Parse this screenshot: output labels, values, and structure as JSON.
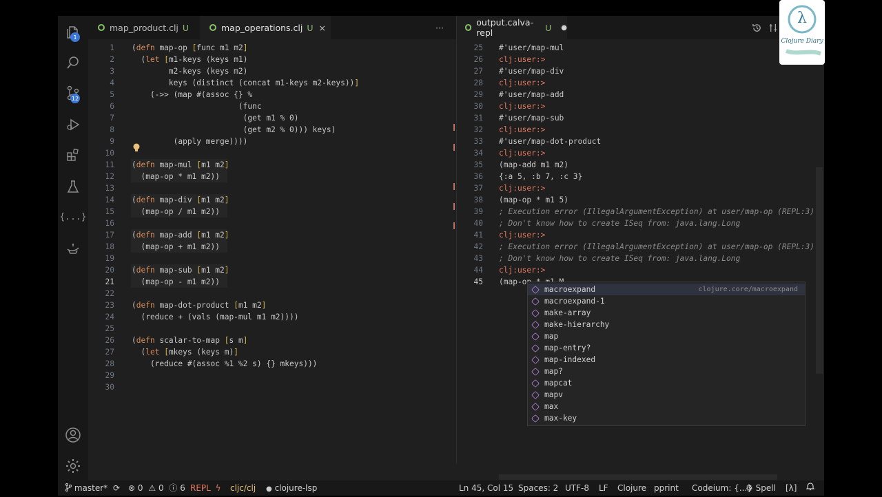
{
  "tabs_left": [
    {
      "label": "map_product.clj",
      "status": "U"
    },
    {
      "label": "map_operations.clj",
      "status": "U",
      "close": "×"
    }
  ],
  "tabs_left_more": "···",
  "tabs_right": [
    {
      "label": "output.calva-repl",
      "status": "U",
      "dirty": "●"
    }
  ],
  "activity_badges": {
    "explorer": "1",
    "scm": "12"
  },
  "activity_text": "{...}",
  "left_editor": {
    "current_line": 21,
    "lines": [
      {
        "n": "1",
        "t": "(defn map-op [func m1 m2]"
      },
      {
        "n": "2",
        "t": "  (let [m1-keys (keys m1)"
      },
      {
        "n": "3",
        "t": "        m2-keys (keys m2)"
      },
      {
        "n": "4",
        "t": "        keys (distinct (concat m1-keys m2-keys))]"
      },
      {
        "n": "5",
        "t": "    (->> (map #(assoc {} %"
      },
      {
        "n": "6",
        "t": "                       (func"
      },
      {
        "n": "7",
        "t": "                        (get m1 % 0)"
      },
      {
        "n": "8",
        "t": "                        (get m2 % 0))) keys)"
      },
      {
        "n": "9",
        "t": "         (apply merge))))"
      },
      {
        "n": "10",
        "t": ""
      },
      {
        "n": "11",
        "t": "(defn map-mul [m1 m2]"
      },
      {
        "n": "12",
        "t": "  (map-op * m1 m2))"
      },
      {
        "n": "13",
        "t": ""
      },
      {
        "n": "14",
        "t": "(defn map-div [m1 m2]"
      },
      {
        "n": "15",
        "t": "  (map-op / m1 m2))"
      },
      {
        "n": "16",
        "t": ""
      },
      {
        "n": "17",
        "t": "(defn map-add [m1 m2]"
      },
      {
        "n": "18",
        "t": "  (map-op + m1 m2))"
      },
      {
        "n": "19",
        "t": ""
      },
      {
        "n": "20",
        "t": "(defn map-sub [m1 m2]"
      },
      {
        "n": "21",
        "t": "  (map-op - m1 m2))"
      },
      {
        "n": "22",
        "t": ""
      },
      {
        "n": "23",
        "t": "(defn map-dot-product [m1 m2]"
      },
      {
        "n": "24",
        "t": "  (reduce + (vals (map-mul m1 m2))))"
      },
      {
        "n": "25",
        "t": ""
      },
      {
        "n": "26",
        "t": "(defn scalar-to-map [s m]"
      },
      {
        "n": "27",
        "t": "  (let [mkeys (keys m)]"
      },
      {
        "n": "28",
        "t": "    (reduce #(assoc %1 %2 s) {} mkeys)))"
      },
      {
        "n": "29",
        "t": ""
      },
      {
        "n": "30",
        "t": ""
      }
    ]
  },
  "repl": {
    "lines": [
      {
        "n": "25",
        "t": "#'user/map-mul",
        "kind": "out"
      },
      {
        "n": "26",
        "t": "clj:user:>",
        "kind": "prompt"
      },
      {
        "n": "27",
        "t": "#'user/map-div",
        "kind": "out"
      },
      {
        "n": "28",
        "t": "clj:user:>",
        "kind": "prompt"
      },
      {
        "n": "29",
        "t": "#'user/map-add",
        "kind": "out"
      },
      {
        "n": "30",
        "t": "clj:user:>",
        "kind": "prompt"
      },
      {
        "n": "31",
        "t": "#'user/map-sub",
        "kind": "out"
      },
      {
        "n": "32",
        "t": "clj:user:>",
        "kind": "prompt"
      },
      {
        "n": "33",
        "t": "#'user/map-dot-product",
        "kind": "out"
      },
      {
        "n": "34",
        "t": "clj:user:>",
        "kind": "prompt"
      },
      {
        "n": "35",
        "t": "(map-add m1 m2)",
        "kind": "out"
      },
      {
        "n": "36",
        "t": "{:a 5, :b 7, :c 3}",
        "kind": "out"
      },
      {
        "n": "37",
        "t": "clj:user:>",
        "kind": "prompt"
      },
      {
        "n": "38",
        "t": "(map-op * m1 5)",
        "kind": "out"
      },
      {
        "n": "39",
        "t": "; Execution error (IllegalArgumentException) at user/map-op (REPL:3).",
        "kind": "comment"
      },
      {
        "n": "40",
        "t": "; Don't know how to create ISeq from: java.lang.Long",
        "kind": "comment"
      },
      {
        "n": "41",
        "t": "clj:user:>",
        "kind": "prompt"
      },
      {
        "n": "42",
        "t": "; Execution error (IllegalArgumentException) at user/map-op (REPL:3).",
        "kind": "comment"
      },
      {
        "n": "43",
        "t": "; Don't know how to create ISeq from: java.lang.Long",
        "kind": "comment"
      },
      {
        "n": "44",
        "t": "clj:user:>",
        "kind": "prompt"
      },
      {
        "n": "45",
        "t": "(map-op * m1 M",
        "kind": "input"
      }
    ]
  },
  "autocomplete": {
    "detail": "clojure.core/macroexpand",
    "items": [
      "macroexpand",
      "macroexpand-1",
      "make-array",
      "make-hierarchy",
      "map",
      "map-entry?",
      "map-indexed",
      "map?",
      "mapcat",
      "mapv",
      "max",
      "max-key"
    ]
  },
  "logo": {
    "symbol": "λ",
    "text": "Clojure Diary"
  },
  "status": {
    "branch": "master*",
    "errors": "0",
    "warnings": "0",
    "info": "6",
    "repl": "REPL",
    "lang_mode": "cljc/clj",
    "lsp": "clojure-lsp",
    "position": "Ln 45, Col 15",
    "spaces": "Spaces: 2",
    "encoding": "UTF-8",
    "eol": "LF",
    "language": "Clojure",
    "pprint": "pprint",
    "codeium": "Codeium: {...}",
    "spell": "Spell",
    "lambda": "[λ]"
  },
  "colors": {
    "keyword": "#d78c5a",
    "fn": "#dcdcaa",
    "bracket": "#d4b44a",
    "prompt": "#e07a5f",
    "comment": "#8a8a8a"
  }
}
